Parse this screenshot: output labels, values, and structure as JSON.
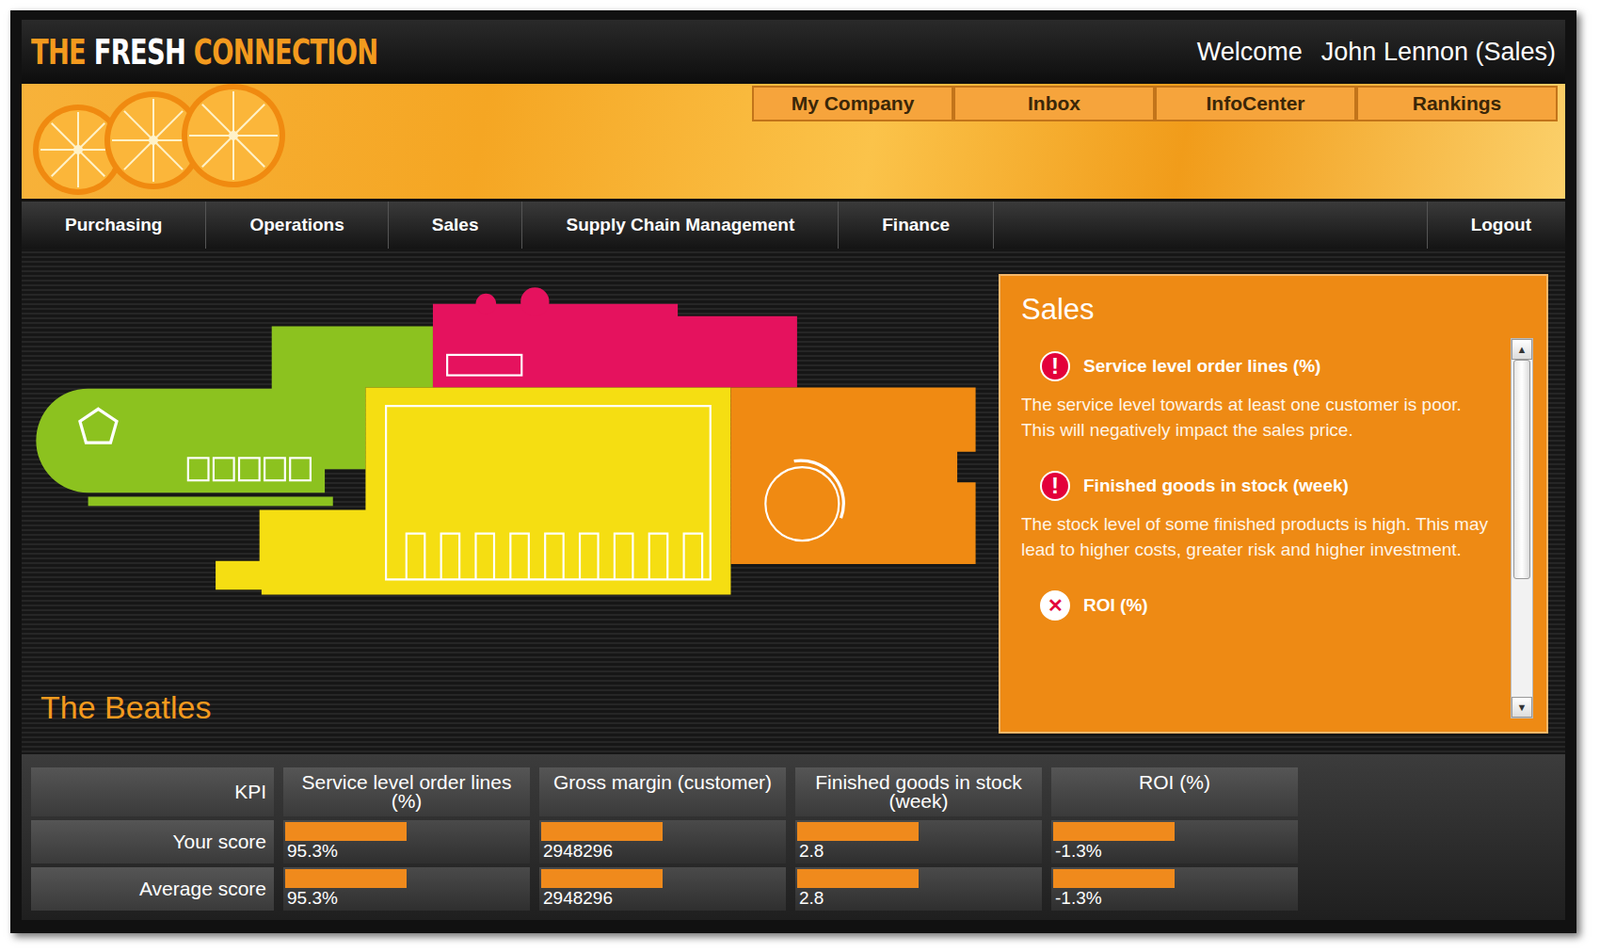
{
  "header": {
    "logo": [
      {
        "text": "THE",
        "color": "#f39a1e"
      },
      {
        "text": "FRESH",
        "color": "#ffffff"
      },
      {
        "text": "CONNECTION",
        "color": "#f39a1e"
      }
    ],
    "welcome": "Welcome",
    "user": "John Lennon (Sales)"
  },
  "top_tabs": [
    {
      "label": "My Company",
      "selected": false
    },
    {
      "label": "Inbox",
      "selected": false
    },
    {
      "label": "InfoCenter",
      "selected": false
    },
    {
      "label": "Rankings",
      "selected": false
    }
  ],
  "nav": {
    "items": [
      {
        "label": "Purchasing",
        "selected": false
      },
      {
        "label": "Operations",
        "selected": false
      },
      {
        "label": "Sales",
        "selected": false
      },
      {
        "label": "Supply Chain Management",
        "selected": false
      },
      {
        "label": "Finance",
        "selected": false
      }
    ],
    "logout": "Logout"
  },
  "team_name": "The Beatles",
  "panel": {
    "title": "Sales",
    "items": [
      {
        "kind": "warning",
        "icon": "!",
        "title": "Service level order lines (%)",
        "text": "The service level towards at least one customer is poor. This will negatively impact the sales price."
      },
      {
        "kind": "warning",
        "icon": "!",
        "title": "Finished goods in stock (week)",
        "text": "The stock level of some finished products is high. This may lead to higher costs, greater risk and higher investment."
      },
      {
        "kind": "error",
        "icon": "✕",
        "title": "ROI (%)",
        "text": ""
      }
    ],
    "scrollbar": {
      "up": "▲",
      "down": "▼",
      "offset": 0,
      "visible_share": 0.65
    }
  },
  "kpi": {
    "label": "KPI",
    "columns": [
      "Service level order lines (%)",
      "Gross margin (customer)",
      "Finished goods in stock (week)",
      "ROI (%)"
    ],
    "rows": [
      {
        "label": "Your score",
        "cells": [
          {
            "value": "95.3%",
            "level": 0.5
          },
          {
            "value": "2948296",
            "level": 0.5
          },
          {
            "value": "2.8",
            "level": 0.5
          },
          {
            "value": "-1.3%",
            "level": 0.5
          }
        ]
      },
      {
        "label": "Average score",
        "cells": [
          {
            "value": "95.3%",
            "level": 0.5
          },
          {
            "value": "2948296",
            "level": 0.5
          },
          {
            "value": "2.8",
            "level": 0.5
          },
          {
            "value": "-1.3%",
            "level": 0.5
          }
        ]
      }
    ]
  }
}
